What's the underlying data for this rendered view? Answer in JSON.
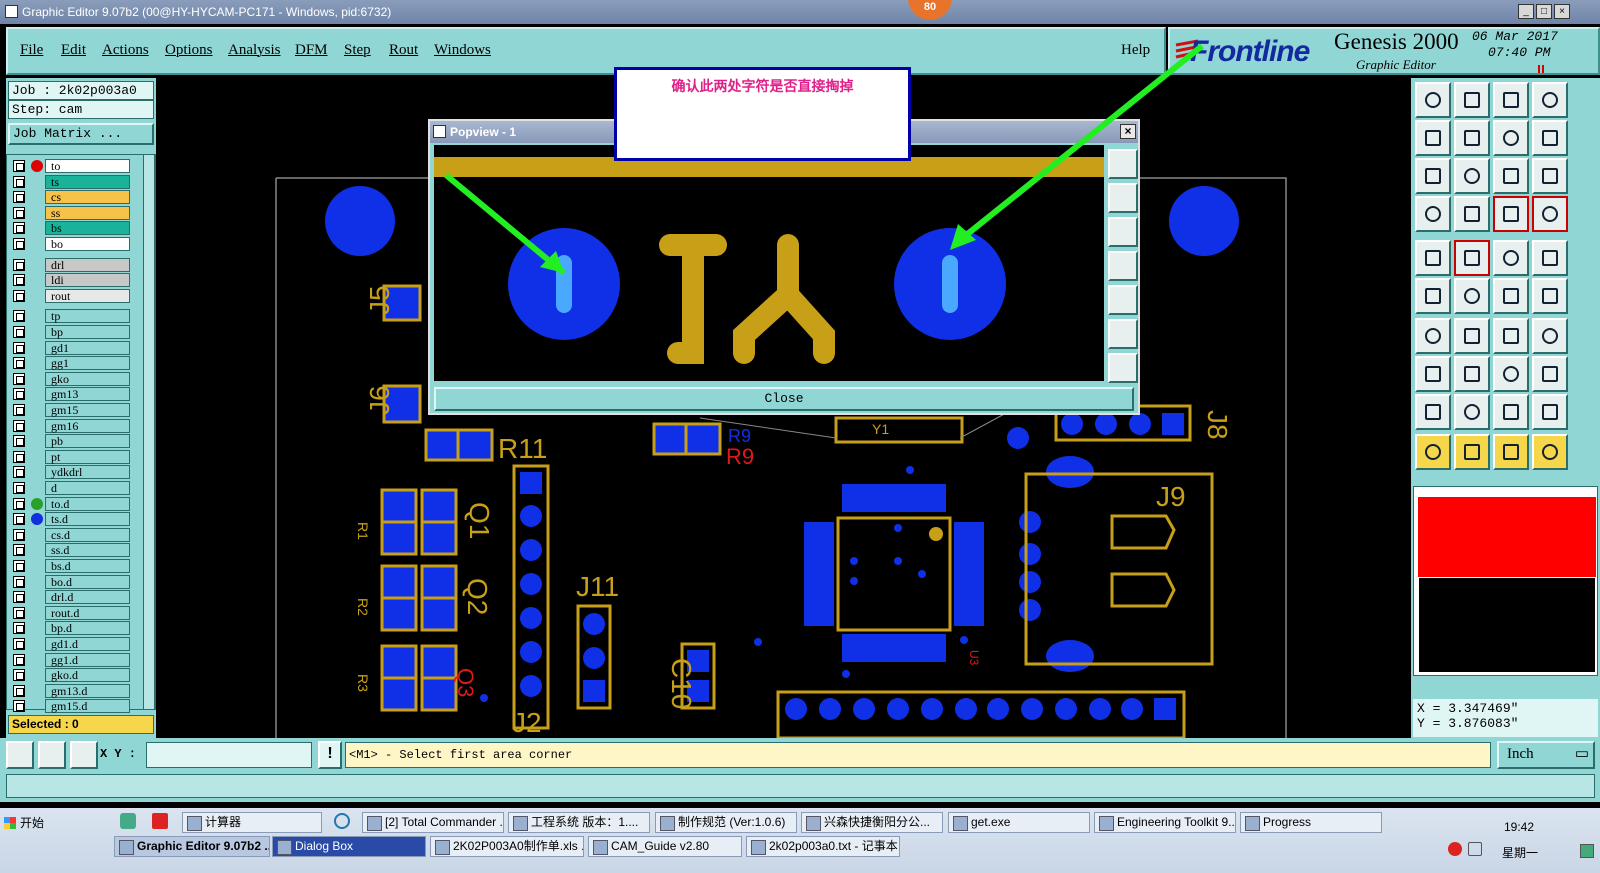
{
  "window": {
    "title": "Graphic Editor 9.07b2 (00@HY-HYCAM-PC171 - Windows, pid:6732)",
    "badge": "80"
  },
  "menu": [
    "File",
    "Edit",
    "Actions",
    "Options",
    "Analysis",
    "DFM",
    "Step",
    "Rout",
    "Windows"
  ],
  "help_label": "Help",
  "brand": {
    "logo": "Frontline",
    "product": "Genesis 2000",
    "subtitle": "Graphic Editor",
    "date": "06 Mar 2017",
    "time": "07:40 PM"
  },
  "job": {
    "job_line": "Job : 2k02p003a0",
    "step_line": "Step: cam",
    "matrix_button": "Job Matrix ...",
    "selected": "Selected : 0"
  },
  "layers": {
    "board": [
      {
        "name": "to",
        "color": "#ffffff",
        "dot": "#e00000"
      },
      {
        "name": "ts",
        "color": "#19b39a",
        "dot": ""
      },
      {
        "name": "cs",
        "color": "#f6c24a",
        "dot": ""
      },
      {
        "name": "ss",
        "color": "#f6c24a",
        "dot": ""
      },
      {
        "name": "bs",
        "color": "#19b39a",
        "dot": ""
      },
      {
        "name": "bo",
        "color": "#ffffff",
        "dot": ""
      }
    ],
    "drill": [
      {
        "name": "drl",
        "color": "#c8c8c8"
      },
      {
        "name": "ldi",
        "color": "#c8c8c8"
      },
      {
        "name": "rout",
        "color": "#e8e8e8"
      }
    ],
    "misc": [
      "tp",
      "bp",
      "gd1",
      "gg1",
      "gko",
      "gm13",
      "gm15",
      "gm16",
      "pb",
      "pt",
      "ydkdrl",
      "d",
      "to.d",
      "ts.d",
      "cs.d",
      "ss.d",
      "bs.d",
      "bo.d",
      "drl.d",
      "rout.d",
      "bp.d",
      "gd1.d",
      "gg1.d",
      "gko.d",
      "gm13.d",
      "gm15.d"
    ],
    "misc_dots": {
      "to.d": "#2aa02a",
      "ts.d": "#1030e0"
    }
  },
  "pcb_labels": [
    "J5",
    "J6",
    "R11",
    "R9",
    "R9",
    "Q1",
    "Q2",
    "Q3",
    "R1",
    "R2",
    "R3",
    "J11",
    "J2",
    "C10",
    "J8",
    "J9",
    "U3",
    "Y1"
  ],
  "popup": {
    "title": "Popview - 1",
    "close_label": "Close"
  },
  "annotation": "确认此两处字符是否直接掏掉",
  "coords": {
    "x": "X = 3.347469\"",
    "y": "Y = 3.876083\""
  },
  "status": {
    "xy_label": "X Y :",
    "xy_value": "",
    "prompt": "<M1> - Select first area corner",
    "units": "Inch"
  },
  "taskbar": {
    "start": "开始",
    "items_row1": [
      "计算器",
      "[2] Total Commander ...",
      "工程系统   版本：1....",
      "制作规范 (Ver:1.0.6)",
      "兴森快捷衡阳分公...",
      "get.exe",
      "Engineering Toolkit 9....",
      "Progress"
    ],
    "items_row2": [
      "Graphic Editor 9.07b2 ...",
      "Dialog Box",
      "2K02P003A0制作单.xls ...",
      "CAM_Guide v2.80",
      "2k02p003a0.txt - 记事本"
    ],
    "clock": "19:42",
    "day": "星期一"
  },
  "colors": {
    "panel": "#8fd6d4",
    "pad_blue": "#1030e8",
    "silk_gold": "#c8a018",
    "arrow_green": "#22ee22"
  }
}
